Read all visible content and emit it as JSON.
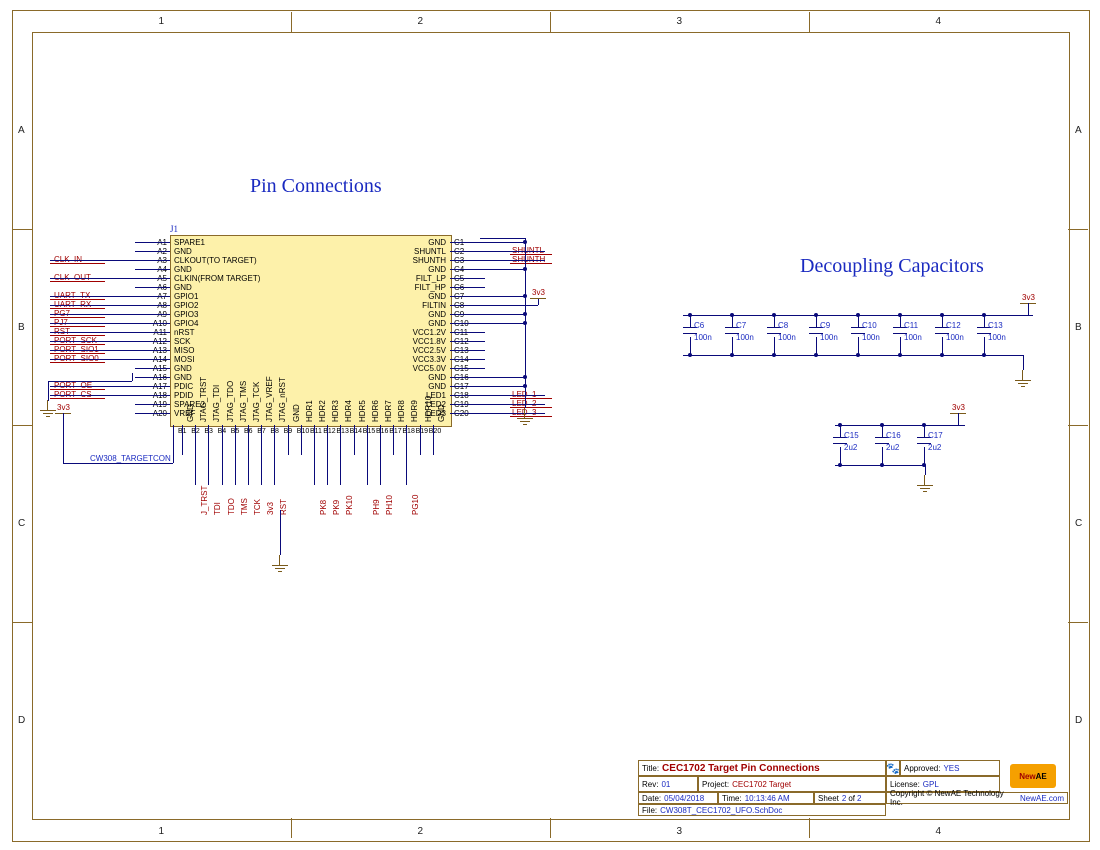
{
  "frame": {
    "cols": [
      "1",
      "2",
      "3",
      "4"
    ],
    "rows": [
      "A",
      "B",
      "C",
      "D"
    ]
  },
  "headings": {
    "left": "Pin Connections",
    "right": "Decoupling Capacitors"
  },
  "connector": {
    "refdes": "J1",
    "partname": "CW308_TARGETCON",
    "left_pins": [
      {
        "num": "A1",
        "name": "SPARE1",
        "net": ""
      },
      {
        "num": "A2",
        "name": "GND",
        "net": ""
      },
      {
        "num": "A3",
        "name": "CLKOUT(TO TARGET)",
        "net": "CLK_IN"
      },
      {
        "num": "A4",
        "name": "GND",
        "net": ""
      },
      {
        "num": "A5",
        "name": "CLKIN(FROM TARGET)",
        "net": "CLK_OUT"
      },
      {
        "num": "A6",
        "name": "GND",
        "net": ""
      },
      {
        "num": "A7",
        "name": "GPIO1",
        "net": "UART_TX"
      },
      {
        "num": "A8",
        "name": "GPIO2",
        "net": "UART_RX"
      },
      {
        "num": "A9",
        "name": "GPIO3",
        "net": "PG7"
      },
      {
        "num": "A10",
        "name": "GPIO4",
        "net": "PJ7"
      },
      {
        "num": "A11",
        "name": "nRST",
        "net": "RST"
      },
      {
        "num": "A12",
        "name": "SCK",
        "net": "PORT_SCK"
      },
      {
        "num": "A13",
        "name": "MISO",
        "net": "PORT_SIO1"
      },
      {
        "num": "A14",
        "name": "MOSI",
        "net": "PORT_SIO0"
      },
      {
        "num": "A15",
        "name": "GND",
        "net": ""
      },
      {
        "num": "A16",
        "name": "GND",
        "net": ""
      },
      {
        "num": "A17",
        "name": "PDIC",
        "net": "PORT_OE"
      },
      {
        "num": "A18",
        "name": "PDID",
        "net": "PORT_CS"
      },
      {
        "num": "A19",
        "name": "SPARE2",
        "net": ""
      },
      {
        "num": "A20",
        "name": "VREF",
        "net": ""
      }
    ],
    "right_pins": [
      {
        "num": "C1",
        "name": "GND",
        "net": ""
      },
      {
        "num": "C2",
        "name": "SHUNTL",
        "net": "SHUNTL"
      },
      {
        "num": "C3",
        "name": "SHUNTH",
        "net": "SHUNTH"
      },
      {
        "num": "C4",
        "name": "GND",
        "net": ""
      },
      {
        "num": "C5",
        "name": "FILT_LP",
        "net": ""
      },
      {
        "num": "C6",
        "name": "FILT_HP",
        "net": ""
      },
      {
        "num": "C7",
        "name": "GND",
        "net": ""
      },
      {
        "num": "C8",
        "name": "FILTIN",
        "net": "3v3"
      },
      {
        "num": "C9",
        "name": "GND",
        "net": ""
      },
      {
        "num": "C10",
        "name": "GND",
        "net": ""
      },
      {
        "num": "C11",
        "name": "VCC1.2V",
        "net": ""
      },
      {
        "num": "C12",
        "name": "VCC1.8V",
        "net": ""
      },
      {
        "num": "C13",
        "name": "VCC2.5V",
        "net": ""
      },
      {
        "num": "C14",
        "name": "VCC3.3V",
        "net": ""
      },
      {
        "num": "C15",
        "name": "VCC5.0V",
        "net": ""
      },
      {
        "num": "C16",
        "name": "GND",
        "net": ""
      },
      {
        "num": "C17",
        "name": "GND",
        "net": ""
      },
      {
        "num": "C18",
        "name": "LED1",
        "net": "LED_1"
      },
      {
        "num": "C19",
        "name": "LED2",
        "net": "LED_2"
      },
      {
        "num": "C20",
        "name": "LED3",
        "net": "LED_3"
      }
    ],
    "bottom_pins": [
      {
        "num": "B1",
        "name": "GND",
        "net": ""
      },
      {
        "num": "B2",
        "name": "JTAG_TRST",
        "net": "J_TRST"
      },
      {
        "num": "B3",
        "name": "JTAG_TDI",
        "net": "TDI"
      },
      {
        "num": "B4",
        "name": "JTAG_TDO",
        "net": "TDO"
      },
      {
        "num": "B5",
        "name": "JTAG_TMS",
        "net": "TMS"
      },
      {
        "num": "B6",
        "name": "JTAG_TCK",
        "net": "TCK"
      },
      {
        "num": "B7",
        "name": "JTAG_VREF",
        "net": "3v3"
      },
      {
        "num": "B8",
        "name": "JTAG_nRST",
        "net": "RST"
      },
      {
        "num": "B9",
        "name": "GND",
        "net": ""
      },
      {
        "num": "B10",
        "name": "HDR1",
        "net": ""
      },
      {
        "num": "B11",
        "name": "HDR2",
        "net": "PK8"
      },
      {
        "num": "B12",
        "name": "HDR3",
        "net": "PK9"
      },
      {
        "num": "B13",
        "name": "HDR4",
        "net": "PK10"
      },
      {
        "num": "B14",
        "name": "HDR5",
        "net": ""
      },
      {
        "num": "B15",
        "name": "HDR6",
        "net": "PH9"
      },
      {
        "num": "B16",
        "name": "HDR7",
        "net": "PH10"
      },
      {
        "num": "B17",
        "name": "HDR8",
        "net": ""
      },
      {
        "num": "B18",
        "name": "HDR9",
        "net": "PG10"
      },
      {
        "num": "B19",
        "name": "HDR10",
        "net": ""
      },
      {
        "num": "B20",
        "name": "GND",
        "net": ""
      }
    ]
  },
  "caps_top": [
    {
      "ref": "C6",
      "val": "100n"
    },
    {
      "ref": "C7",
      "val": "100n"
    },
    {
      "ref": "C8",
      "val": "100n"
    },
    {
      "ref": "C9",
      "val": "100n"
    },
    {
      "ref": "C10",
      "val": "100n"
    },
    {
      "ref": "C11",
      "val": "100n"
    },
    {
      "ref": "C12",
      "val": "100n"
    },
    {
      "ref": "C13",
      "val": "100n"
    }
  ],
  "caps_bot": [
    {
      "ref": "C15",
      "val": "2u2"
    },
    {
      "ref": "C16",
      "val": "2u2"
    },
    {
      "ref": "C17",
      "val": "2u2"
    }
  ],
  "power": {
    "rail": "3v3"
  },
  "titleblock": {
    "title_label": "Title:",
    "title": "CEC1702 Target Pin Connections",
    "rev_label": "Rev:",
    "rev": "01",
    "project_label": "Project:",
    "project": "CEC1702 Target",
    "approved_label": "Approved:",
    "approved": "YES",
    "license_label": "License:",
    "license": "GPL",
    "date_label": "Date:",
    "date": "05/04/2018",
    "time_label": "Time:",
    "time": "10:13:46 AM",
    "sheet_label": "Sheet",
    "sheet_num": "2",
    "sheet_of": "of",
    "sheet_total": "2",
    "file_label": "File:",
    "file": "CW308T_CEC1702_UFO.SchDoc",
    "copyright": "Copyright © NewAE Technology Inc.",
    "url": "NewAE.com",
    "logo_a": "New",
    "logo_b": "AE"
  }
}
